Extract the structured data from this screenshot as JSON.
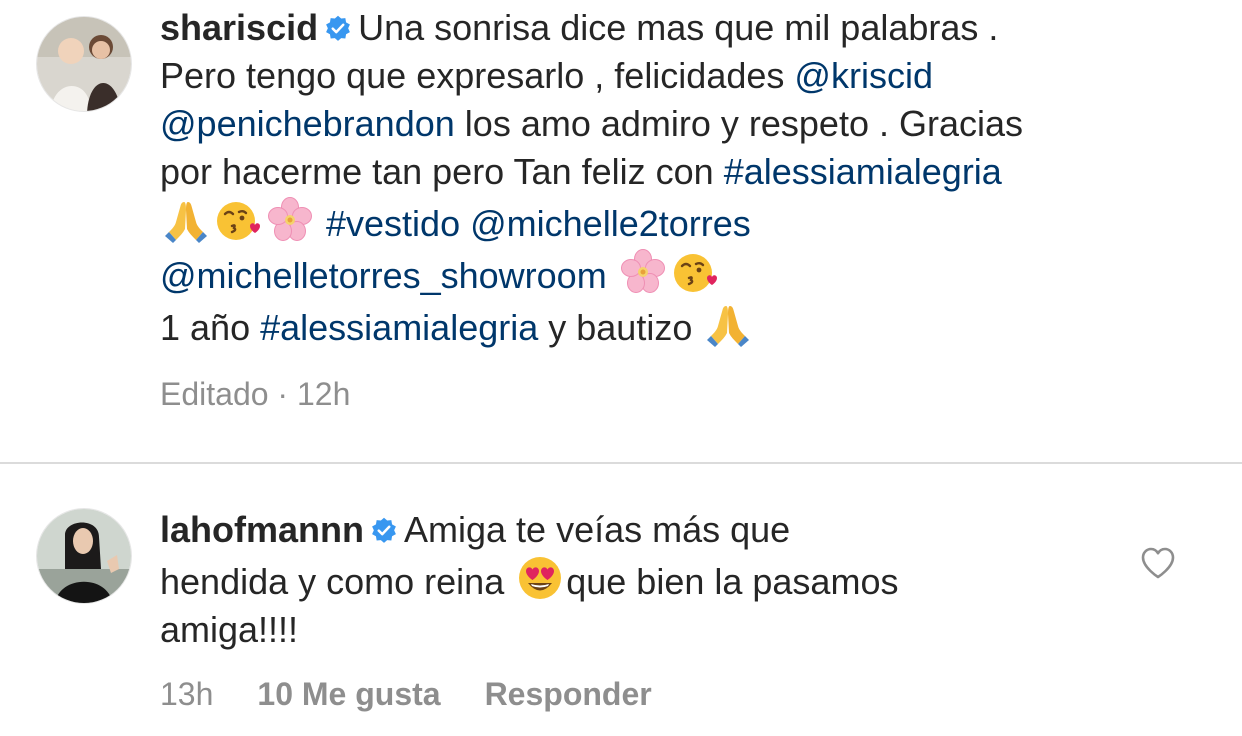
{
  "comments": [
    {
      "username": "shariscid",
      "lines": [
        "Una sonrisa dice mas que mil palabras .",
        "Pero tengo que expresarlo , felicidades",
        "@kriscid",
        "@penichebrandon",
        "los amo admiro y respeto . Gracias",
        "por hacerme tan pero Tan feliz con",
        "#alessiamialegria",
        "#vestido",
        "@michelle2torres",
        "@michelletorres_showroom",
        "1 año",
        "#alessiamialegria",
        "y bautizo"
      ],
      "meta": "Editado · 12h"
    },
    {
      "username": "lahofmannn",
      "lines": [
        "Amiga te veías más que",
        "hendida y como reina",
        "que bien la pasamos",
        "amiga!!!!"
      ],
      "time": "13h",
      "likes": "10 Me gusta",
      "reply": "Responder"
    }
  ],
  "icons": {
    "verified": "verified-badge-icon",
    "heart": "heart-outline-icon",
    "emojis": [
      "folded-hands",
      "face-blowing-kiss",
      "cherry-blossom",
      "smiling-face-with-heart-eyes"
    ]
  },
  "colors": {
    "link": "#00376b",
    "text": "#262626",
    "muted": "#8e8e8e",
    "verified": "#3897f0"
  }
}
